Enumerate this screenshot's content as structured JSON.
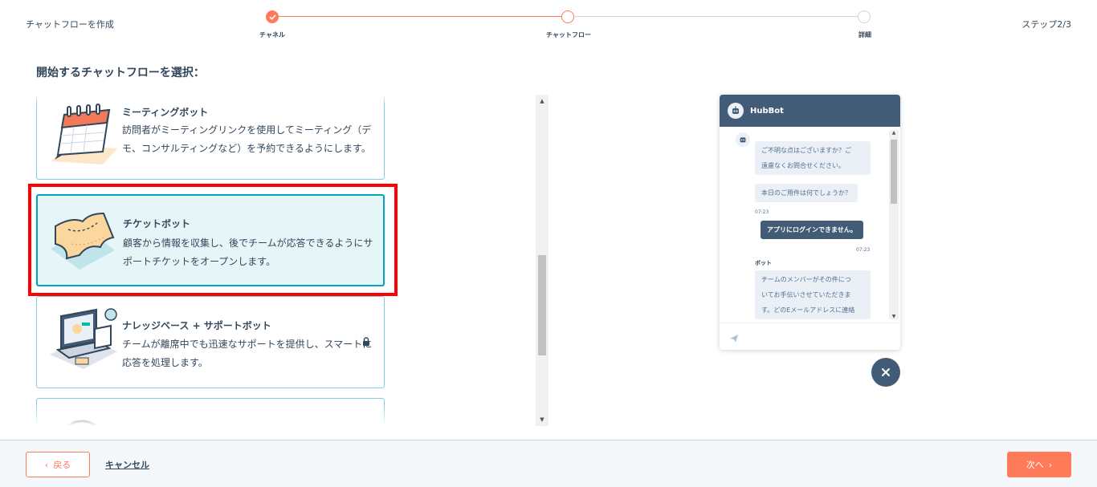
{
  "header": {
    "title": "チャットフローを作成",
    "step_counter": "ステップ2/3",
    "steps": [
      {
        "label": "チャネル",
        "state": "done"
      },
      {
        "label": "チャットフロー",
        "state": "current"
      },
      {
        "label": "詳細",
        "state": "todo"
      }
    ]
  },
  "section_title": "開始するチャットフローを選択：",
  "cards": [
    {
      "name": "ミーティングボット",
      "desc": "訪問者がミーティングリンクを使用してミーティング（デモ、コンサルティングなど）を予約できるようにします。",
      "icon": "calendar-icon"
    },
    {
      "name": "チケットボット",
      "desc": "顧客から情報を収集し、後でチームが応答できるようにサポートチケットをオープンします。",
      "icon": "ticket-icon",
      "selected": true
    },
    {
      "name": "ナレッジベース + サポートボット",
      "desc": "チームが離席中でも迅速なサポートを提供し、スマートに応答を処理します。",
      "icon": "computer-icon",
      "locked": true
    },
    {
      "name": "",
      "desc": "",
      "icon": "clock-icon"
    }
  ],
  "preview": {
    "bot_name": "HubBot",
    "messages": [
      {
        "from": "bot",
        "text_lines": [
          "ご不明な点はございますか？ご",
          "遠慮なくお問合せください。"
        ]
      },
      {
        "from": "bot",
        "text_lines": [
          "本日のご用件は何でしょうか？"
        ]
      },
      {
        "from": "bot_time",
        "text": "07:23"
      },
      {
        "from": "user",
        "text": "アプリにログインできません。"
      },
      {
        "from": "user_time",
        "text": "07:23"
      },
      {
        "from": "bot_label",
        "text": "ボット"
      },
      {
        "from": "bot",
        "text_lines": [
          "チームのメンバーがその件につ",
          "いてお手伝いさせていただきま",
          "す。どのEメールアドレスに連絡"
        ]
      }
    ]
  },
  "footer": {
    "back_label": "戻る",
    "cancel_label": "キャンセル",
    "next_label": "次へ"
  },
  "colors": {
    "accent": "#ff7a59",
    "selected_border": "#00a4bd",
    "selected_bg": "#e5f5f8",
    "preview_header": "#425b76",
    "highlight": "#ff0000"
  }
}
